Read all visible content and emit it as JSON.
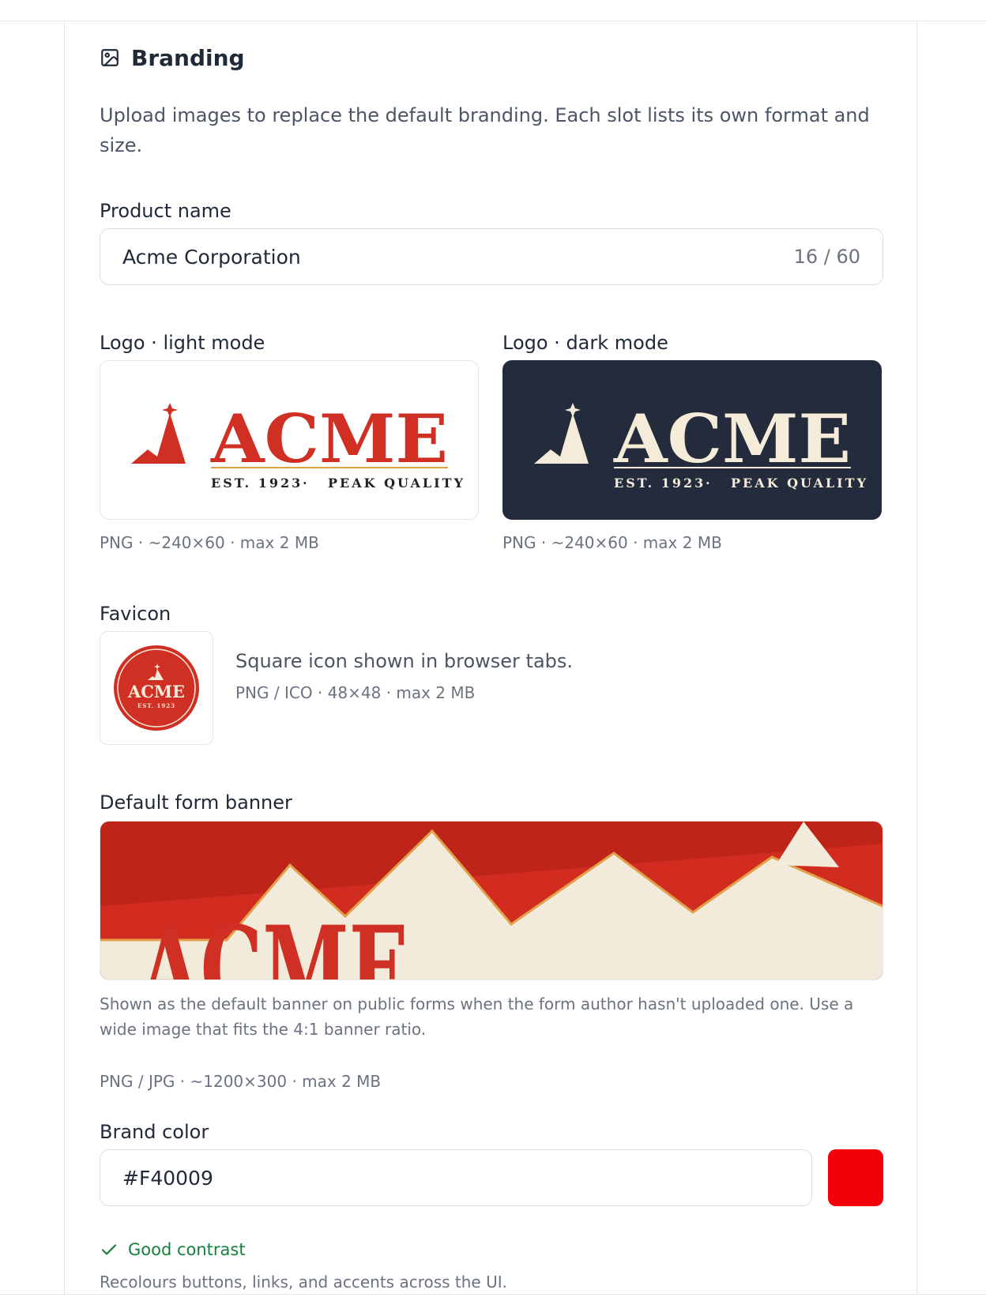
{
  "section": {
    "icon": "image-icon",
    "title": "Branding",
    "description": "Upload images to replace the default branding. Each slot lists its own format and size."
  },
  "product_name": {
    "label": "Product name",
    "value": "Acme Corporation",
    "counter": "16 / 60"
  },
  "logo_light": {
    "label": "Logo · light mode",
    "meta": "PNG · ~240×60 · max 2 MB",
    "background": "#ffffff"
  },
  "logo_dark": {
    "label": "Logo · dark mode",
    "meta": "PNG · ~240×60 · max 2 MB",
    "background": "#232b3c"
  },
  "logo_art": {
    "wordmark": "ACME",
    "est": "EST. 1923",
    "dot": "·",
    "tagline": "PEAK QUALITY",
    "est_short": "EST. 1923",
    "light_color": "#d03024",
    "dark_color": "#f4ebd9"
  },
  "favicon": {
    "label": "Favicon",
    "title": "Square icon shown in browser tabs.",
    "meta": "PNG / ICO · 48×48 · max 2 MB"
  },
  "banner": {
    "label": "Default form banner",
    "help": "Shown as the default banner on public forms when the form author hasn't uploaded one. Use a wide image that fits the 4:1 banner ratio.",
    "meta": "PNG / JPG · ~1200×300 · max 2 MB"
  },
  "brand_color": {
    "label": "Brand color",
    "value": "#F40009",
    "swatch": "#F40009",
    "status_icon": "check-icon",
    "status": "Good contrast",
    "status_color": "#15803d",
    "help": "Recolours buttons, links, and accents across the UI."
  }
}
